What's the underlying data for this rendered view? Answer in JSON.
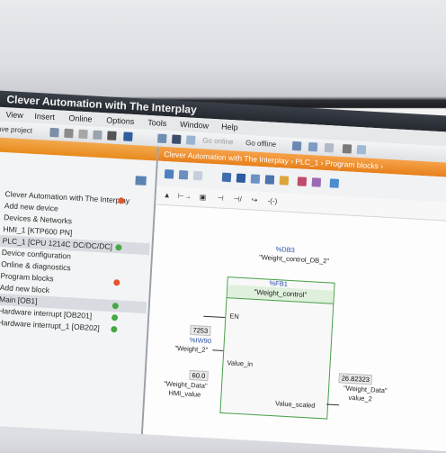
{
  "window": {
    "title": "Clever Automation with The Interplay"
  },
  "menu": [
    "View",
    "Insert",
    "Online",
    "Options",
    "Tools",
    "Window",
    "Help"
  ],
  "toolbar": {
    "save_project": "Save project",
    "go_online": "Go online",
    "go_offline": "Go offline"
  },
  "left_panel": {
    "tree": [
      {
        "label": "Clever Automation with The Interplay",
        "status": "warning",
        "status_color": "#e8552b"
      },
      {
        "label": "Add new device"
      },
      {
        "label": "Devices & Networks"
      },
      {
        "label": "HMI_1 [KTP600 PN]"
      },
      {
        "label": "PLC_1 [CPU 1214C DC/DC/DC]",
        "status": "ok",
        "status_color": "#44a844",
        "selected": true
      },
      {
        "label": "Device configuration"
      },
      {
        "label": "Online & diagnostics"
      },
      {
        "label": "Program blocks",
        "status": "warning",
        "status_color": "#e8552b"
      },
      {
        "label": "Add new block"
      },
      {
        "label": "Main [OB1]",
        "status": "ok",
        "status_color": "#44a844"
      },
      {
        "label": "Hardware interrupt [OB201]",
        "status": "ok",
        "status_color": "#44a844"
      },
      {
        "label": "Hardware interrupt_1 [OB202]",
        "status": "ok",
        "status_color": "#44a844"
      }
    ]
  },
  "editor": {
    "breadcrumb": "Clever Automation with The Interplay  ›  PLC_1  ›  Program blocks  ›",
    "block": {
      "db_address": "%DB3",
      "db_name": "\"Weight_control_DB_2\"",
      "fb_address": "%FB1",
      "fb_name": "\"Weight_control\"",
      "en": "EN",
      "in_value": "7253",
      "in_address": "%IW90",
      "in_tag": "\"Weight_2\"",
      "in_pin": "Value_in",
      "in_value2": "60.0",
      "in_tag2": "\"Weight_Data\"",
      "in_tag2_sub": "HMI_value",
      "out_value": "26.82323",
      "out_pin": "Value_scaled",
      "out_tag": "\"Weight_Data\"",
      "out_tag_sub": "value_2"
    }
  }
}
